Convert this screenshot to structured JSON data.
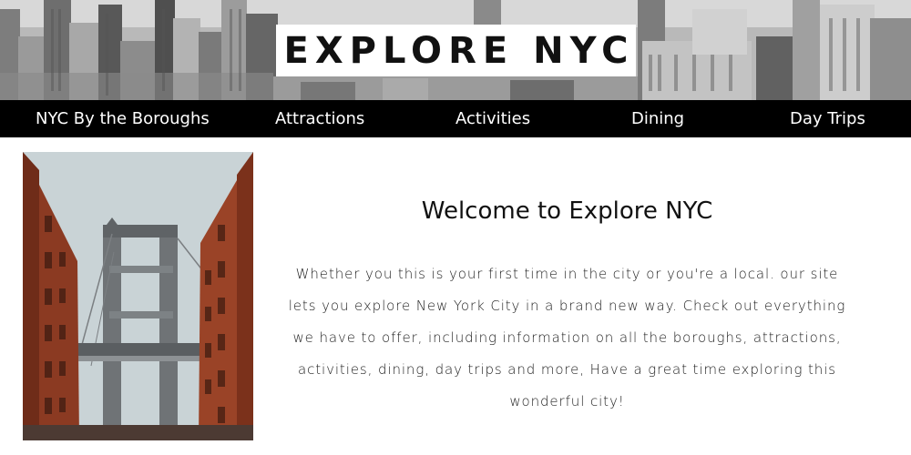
{
  "header": {
    "title": "EXPLORE NYC",
    "background_image": "nyc-skyline-grayscale"
  },
  "nav": {
    "items": [
      {
        "label": "NYC By the Boroughs"
      },
      {
        "label": "Attractions"
      },
      {
        "label": "Activities"
      },
      {
        "label": "Dining"
      },
      {
        "label": "Day Trips"
      }
    ]
  },
  "main": {
    "image": "manhattan-bridge-photo",
    "heading": "Welcome to Explore NYC",
    "intro": "Whether you this is your first time in the city or you're a local. our site lets you explore New York City in a brand new way. Check out everything we have to offer, including information on all the boroughs, attractions, activities, dining, day trips and more, Have a great time exploring this wonderful city!"
  },
  "colors": {
    "nav_background": "#000000",
    "nav_text": "#ffffff",
    "brick": "#8b3a22",
    "sky": "#c9d3d6"
  }
}
